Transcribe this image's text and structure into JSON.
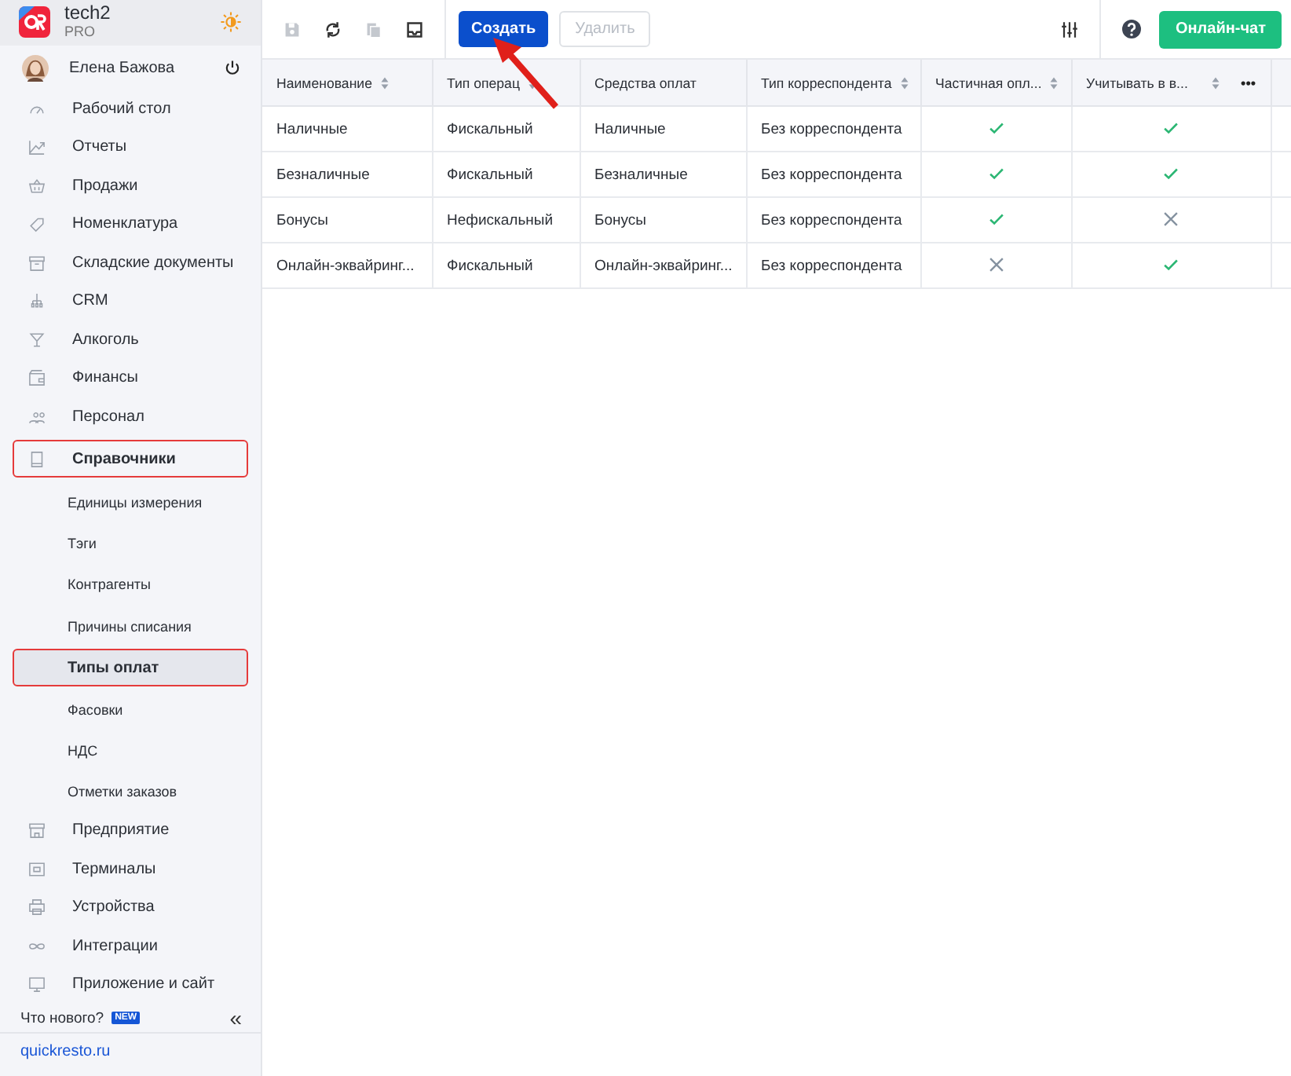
{
  "account": {
    "name": "tech2",
    "plan": "PRO"
  },
  "user": {
    "name": "Елена Бажова"
  },
  "sidebar": {
    "items": [
      {
        "label": "Рабочий стол",
        "selected": false
      },
      {
        "label": "Отчеты",
        "selected": false
      },
      {
        "label": "Продажи",
        "selected": false
      },
      {
        "label": "Номенклатура",
        "selected": false
      },
      {
        "label": "Складские документы",
        "selected": false
      },
      {
        "label": "CRM",
        "selected": false
      },
      {
        "label": "Алкоголь",
        "selected": false
      },
      {
        "label": "Финансы",
        "selected": false
      },
      {
        "label": "Персонал",
        "selected": false
      },
      {
        "label": "Справочники",
        "selected": true,
        "children": [
          {
            "label": "Единицы измерения",
            "selected": false
          },
          {
            "label": "Тэги",
            "selected": false
          },
          {
            "label": "Контрагенты",
            "selected": false
          },
          {
            "label": "Причины списания",
            "selected": false
          },
          {
            "label": "Типы оплат",
            "selected": true
          },
          {
            "label": "Фасовки",
            "selected": false
          },
          {
            "label": "НДС",
            "selected": false
          },
          {
            "label": "Отметки заказов",
            "selected": false
          }
        ]
      },
      {
        "label": "Предприятие",
        "selected": false
      },
      {
        "label": "Терминалы",
        "selected": false
      },
      {
        "label": "Устройства",
        "selected": false
      },
      {
        "label": "Интеграции",
        "selected": false
      },
      {
        "label": "Приложение и сайт",
        "selected": false
      }
    ],
    "whats_new": "Что нового?",
    "new_badge": "NEW",
    "collapse": "«",
    "site_link": "quickresto.ru"
  },
  "toolbar": {
    "create": "Создать",
    "delete": "Удалить",
    "delete_disabled": true,
    "chat": "Онлайн-чат"
  },
  "table": {
    "columns": [
      {
        "label": "Наименование",
        "sortable": true
      },
      {
        "label": "Тип операц",
        "sortable": true
      },
      {
        "label": "Средства оплат",
        "sortable": false
      },
      {
        "label": "Тип корреспондента",
        "sortable": true
      },
      {
        "label": "Частичная опл...",
        "sortable": true
      },
      {
        "label": "Учитывать в в...",
        "sortable": true
      }
    ],
    "more": "•••",
    "rows": [
      {
        "name": "Наличные",
        "operation": "Фискальный",
        "means": "Наличные",
        "correspondent": "Без корреспондента",
        "partial": true,
        "account": true
      },
      {
        "name": "Безналичные",
        "operation": "Фискальный",
        "means": "Безналичные",
        "correspondent": "Без корреспондента",
        "partial": true,
        "account": true
      },
      {
        "name": "Бонусы",
        "operation": "Нефискальный",
        "means": "Бонусы",
        "correspondent": "Без корреспондента",
        "partial": true,
        "account": false
      },
      {
        "name": "Онлайн-эквайринг...",
        "operation": "Фискальный",
        "means": "Онлайн-эквайринг...",
        "correspondent": "Без корреспондента",
        "partial": false,
        "account": true
      }
    ]
  }
}
